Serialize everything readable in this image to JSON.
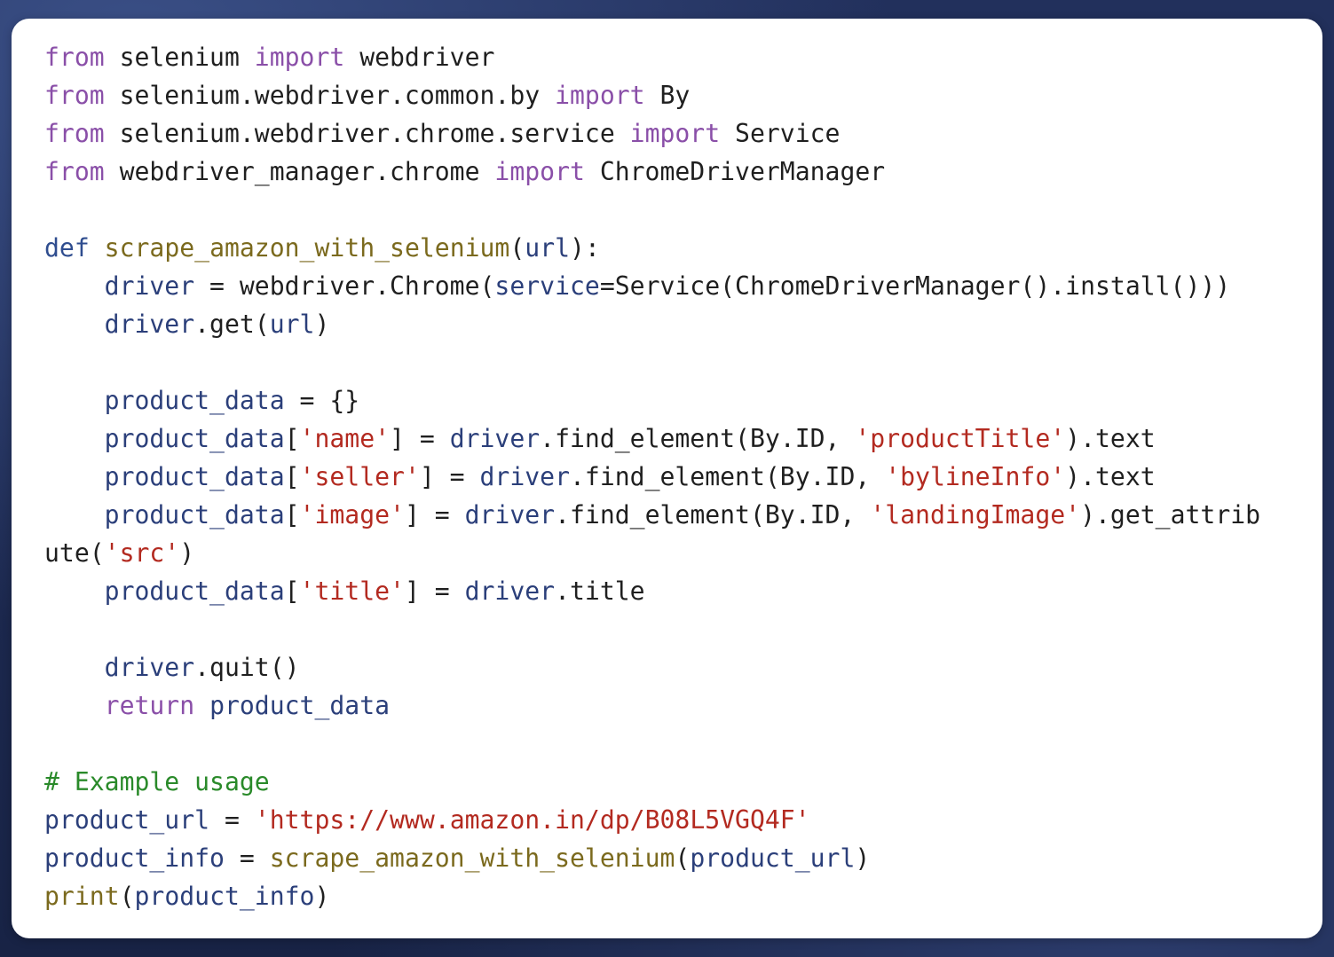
{
  "code_lines": [
    [
      {
        "t": "from",
        "c": "kw"
      },
      {
        "t": " selenium ",
        "c": "pl"
      },
      {
        "t": "import",
        "c": "kw"
      },
      {
        "t": " webdriver",
        "c": "pl"
      }
    ],
    [
      {
        "t": "from",
        "c": "kw"
      },
      {
        "t": " selenium.webdriver.common.by ",
        "c": "pl"
      },
      {
        "t": "import",
        "c": "kw"
      },
      {
        "t": " By",
        "c": "pl"
      }
    ],
    [
      {
        "t": "from",
        "c": "kw"
      },
      {
        "t": " selenium.webdriver.chrome.service ",
        "c": "pl"
      },
      {
        "t": "import",
        "c": "kw"
      },
      {
        "t": " Service",
        "c": "pl"
      }
    ],
    [
      {
        "t": "from",
        "c": "kw"
      },
      {
        "t": " webdriver_manager.chrome ",
        "c": "pl"
      },
      {
        "t": "import",
        "c": "kw"
      },
      {
        "t": " ChromeDriverManager",
        "c": "pl"
      }
    ],
    [],
    [
      {
        "t": "def",
        "c": "def"
      },
      {
        "t": " ",
        "c": "pl"
      },
      {
        "t": "scrape_amazon_with_selenium",
        "c": "fn"
      },
      {
        "t": "(",
        "c": "pl"
      },
      {
        "t": "url",
        "c": "var"
      },
      {
        "t": "):",
        "c": "pl"
      }
    ],
    [
      {
        "t": "    ",
        "c": "pl"
      },
      {
        "t": "driver",
        "c": "var"
      },
      {
        "t": " = webdriver.Chrome(",
        "c": "pl"
      },
      {
        "t": "service",
        "c": "var"
      },
      {
        "t": "=Service(ChromeDriverManager().install()))",
        "c": "pl"
      }
    ],
    [
      {
        "t": "    ",
        "c": "pl"
      },
      {
        "t": "driver",
        "c": "var"
      },
      {
        "t": ".get(",
        "c": "pl"
      },
      {
        "t": "url",
        "c": "var"
      },
      {
        "t": ")",
        "c": "pl"
      }
    ],
    [],
    [
      {
        "t": "    ",
        "c": "pl"
      },
      {
        "t": "product_data",
        "c": "var"
      },
      {
        "t": " = {}",
        "c": "pl"
      }
    ],
    [
      {
        "t": "    ",
        "c": "pl"
      },
      {
        "t": "product_data",
        "c": "var"
      },
      {
        "t": "[",
        "c": "pl"
      },
      {
        "t": "'name'",
        "c": "str"
      },
      {
        "t": "] = ",
        "c": "pl"
      },
      {
        "t": "driver",
        "c": "var"
      },
      {
        "t": ".find_element(By.ID, ",
        "c": "pl"
      },
      {
        "t": "'productTitle'",
        "c": "str"
      },
      {
        "t": ").text",
        "c": "pl"
      }
    ],
    [
      {
        "t": "    ",
        "c": "pl"
      },
      {
        "t": "product_data",
        "c": "var"
      },
      {
        "t": "[",
        "c": "pl"
      },
      {
        "t": "'seller'",
        "c": "str"
      },
      {
        "t": "] = ",
        "c": "pl"
      },
      {
        "t": "driver",
        "c": "var"
      },
      {
        "t": ".find_element(By.ID, ",
        "c": "pl"
      },
      {
        "t": "'bylineInfo'",
        "c": "str"
      },
      {
        "t": ").text",
        "c": "pl"
      }
    ],
    [
      {
        "t": "    ",
        "c": "pl"
      },
      {
        "t": "product_data",
        "c": "var"
      },
      {
        "t": "[",
        "c": "pl"
      },
      {
        "t": "'image'",
        "c": "str"
      },
      {
        "t": "] = ",
        "c": "pl"
      },
      {
        "t": "driver",
        "c": "var"
      },
      {
        "t": ".find_element(By.ID, ",
        "c": "pl"
      },
      {
        "t": "'landingImage'",
        "c": "str"
      },
      {
        "t": ").get_attrib",
        "c": "pl"
      }
    ],
    [
      {
        "t": "ute(",
        "c": "pl"
      },
      {
        "t": "'src'",
        "c": "str"
      },
      {
        "t": ")",
        "c": "pl"
      }
    ],
    [
      {
        "t": "    ",
        "c": "pl"
      },
      {
        "t": "product_data",
        "c": "var"
      },
      {
        "t": "[",
        "c": "pl"
      },
      {
        "t": "'title'",
        "c": "str"
      },
      {
        "t": "] = ",
        "c": "pl"
      },
      {
        "t": "driver",
        "c": "var"
      },
      {
        "t": ".title",
        "c": "pl"
      }
    ],
    [],
    [
      {
        "t": "    ",
        "c": "pl"
      },
      {
        "t": "driver",
        "c": "var"
      },
      {
        "t": ".quit()",
        "c": "pl"
      }
    ],
    [
      {
        "t": "    ",
        "c": "pl"
      },
      {
        "t": "return",
        "c": "kw"
      },
      {
        "t": " ",
        "c": "pl"
      },
      {
        "t": "product_data",
        "c": "var"
      }
    ],
    [],
    [
      {
        "t": "# Example usage",
        "c": "cmt"
      }
    ],
    [
      {
        "t": "product_url",
        "c": "var"
      },
      {
        "t": " = ",
        "c": "pl"
      },
      {
        "t": "'https://www.amazon.in/dp/B08L5VGQ4F'",
        "c": "str"
      }
    ],
    [
      {
        "t": "product_info",
        "c": "var"
      },
      {
        "t": " = ",
        "c": "pl"
      },
      {
        "t": "scrape_amazon_with_selenium",
        "c": "fn"
      },
      {
        "t": "(",
        "c": "pl"
      },
      {
        "t": "product_url",
        "c": "var"
      },
      {
        "t": ")",
        "c": "pl"
      }
    ],
    [
      {
        "t": "print",
        "c": "fn"
      },
      {
        "t": "(",
        "c": "pl"
      },
      {
        "t": "product_info",
        "c": "var"
      },
      {
        "t": ")",
        "c": "pl"
      }
    ]
  ],
  "theme": {
    "background": "#1f2b52",
    "card": "#ffffff",
    "keyword": "#8a4fa8",
    "def_keyword": "#2f4d8f",
    "function": "#7b6a1e",
    "variable": "#2b3f7a",
    "string": "#b32a20",
    "comment": "#2a8a2a",
    "plain": "#1f1f1f"
  }
}
